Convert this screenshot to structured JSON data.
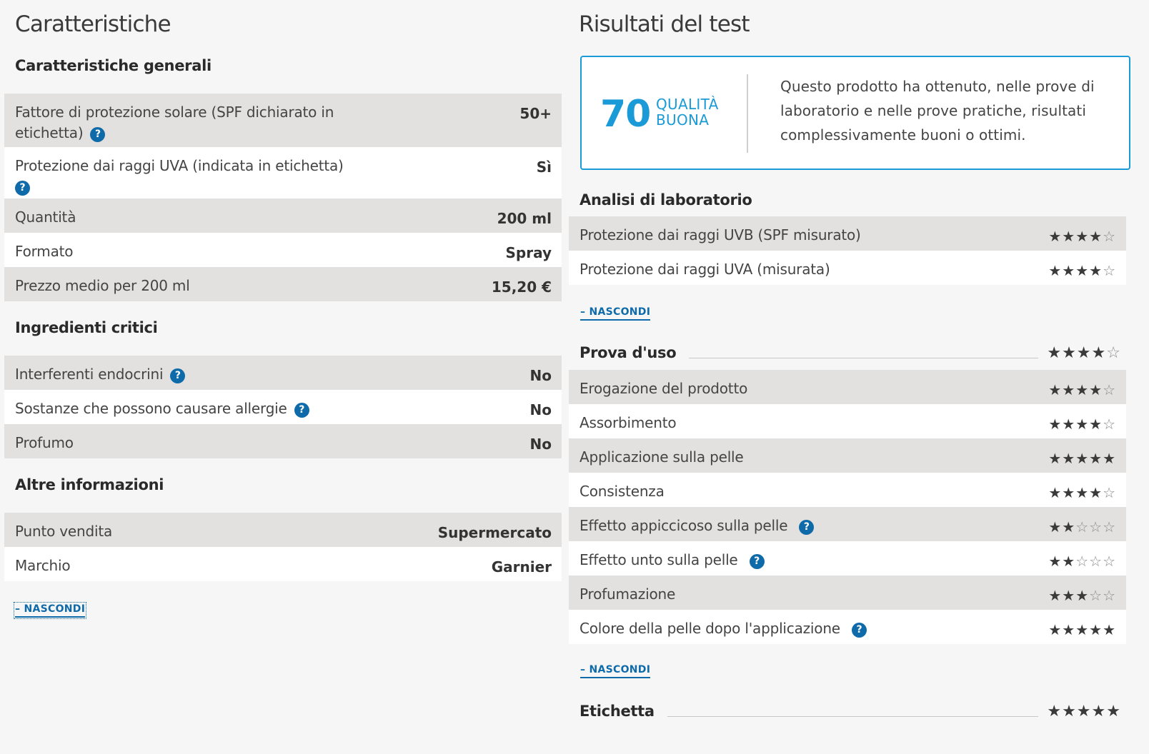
{
  "left": {
    "title": "Caratteristiche",
    "general": {
      "title": "Caratteristiche generali",
      "rows": [
        {
          "label": "Fattore di protezione solare (SPF dichiarato in etichetta)",
          "value": "50+"
        },
        {
          "label": "Protezione dai raggi UVA (indicata in etichetta)",
          "value": "Sì"
        },
        {
          "label": "Quantità",
          "value": "200 ml"
        },
        {
          "label": "Formato",
          "value": "Spray"
        },
        {
          "label": "Prezzo medio per 200 ml",
          "value": "15,20 €"
        }
      ]
    },
    "ingredients": {
      "title": "Ingredienti critici",
      "rows": [
        {
          "label": "Interferenti endocrini",
          "value": "No"
        },
        {
          "label": "Sostanze che possono causare allergie",
          "value": "No"
        },
        {
          "label": "Profumo",
          "value": "No"
        }
      ]
    },
    "other": {
      "title": "Altre informazioni",
      "rows": [
        {
          "label": "Punto vendita",
          "value": "Supermercato"
        },
        {
          "label": "Marchio",
          "value": "Garnier"
        }
      ]
    },
    "hide_label": "– NASCONDI"
  },
  "right": {
    "title": "Risultati del test",
    "score": {
      "value": "70",
      "label_line1": "QUALITÀ",
      "label_line2": "BUONA",
      "description": "Questo prodotto ha ottenuto, nelle prove di laboratorio e nelle prove pratiche, risultati complessivamente buoni o ottimi.",
      "accent_color": "#1a9ad6"
    },
    "lab": {
      "title": "Analisi di laboratorio",
      "rows": [
        {
          "label": "Protezione dai raggi UVB (SPF misurato)",
          "stars": 4
        },
        {
          "label": "Protezione dai raggi UVA (misurata)",
          "stars": 4
        }
      ]
    },
    "usage": {
      "title": "Prova d'uso",
      "stars": 4,
      "rows": [
        {
          "label": "Erogazione del prodotto",
          "stars": 4
        },
        {
          "label": "Assorbimento",
          "stars": 4
        },
        {
          "label": "Applicazione sulla pelle",
          "stars": 5
        },
        {
          "label": "Consistenza",
          "stars": 4
        },
        {
          "label": "Effetto appiccicoso sulla pelle",
          "stars": 2
        },
        {
          "label": "Effetto unto sulla pelle",
          "stars": 2
        },
        {
          "label": "Profumazione",
          "stars": 3
        },
        {
          "label": "Colore della pelle dopo l'applicazione",
          "stars": 5
        }
      ]
    },
    "label_section": {
      "title": "Etichetta",
      "stars": 5
    },
    "hide_label": "– NASCONDI"
  },
  "icons": {
    "help": "question-mark-icon",
    "star_full": "★",
    "star_empty": "☆",
    "help_glyph": "?"
  }
}
